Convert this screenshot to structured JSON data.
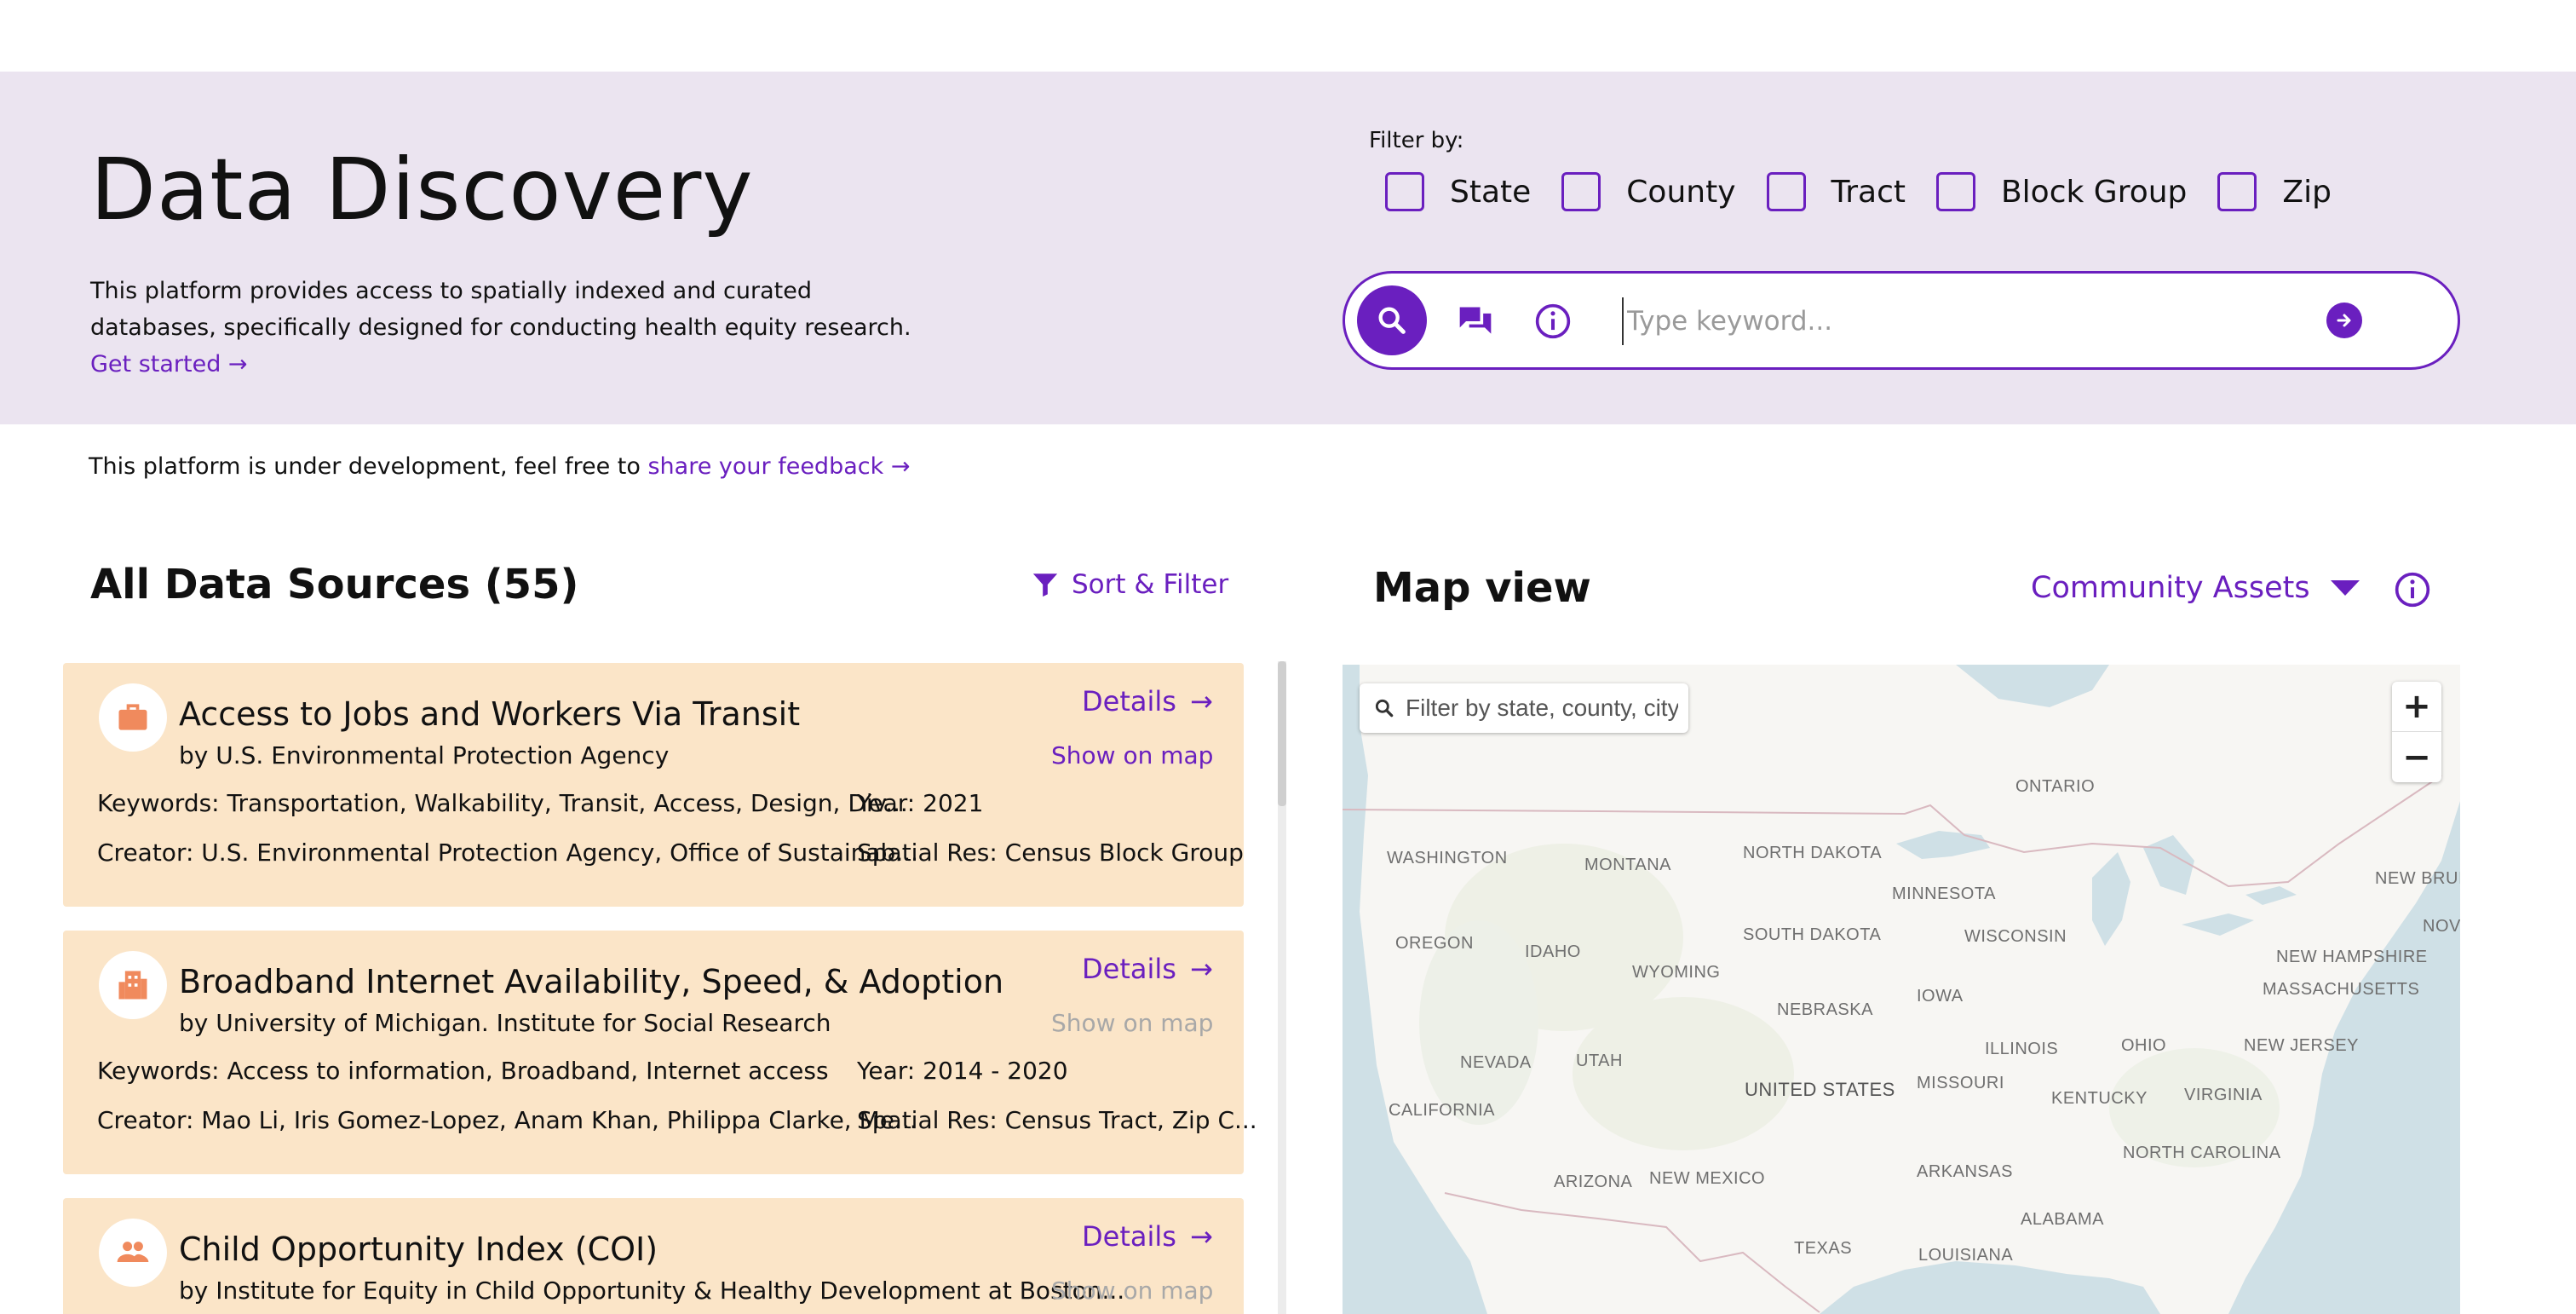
{
  "hero": {
    "title": "Data Discovery",
    "description": "This platform provides access to spatially indexed and curated databases, specifically designed for conducting health equity research.",
    "get_started": "Get started →"
  },
  "filter": {
    "label": "Filter by:",
    "options": [
      "State",
      "County",
      "Tract",
      "Block Group",
      "Zip"
    ]
  },
  "search": {
    "placeholder": "Type keyword...",
    "icons": [
      "search-icon",
      "chat-icon",
      "info-icon",
      "arrow-right-icon"
    ]
  },
  "notice": {
    "text": "This platform is under development, feel free to",
    "link": "share your feedback →"
  },
  "list": {
    "title": "All Data Sources (55)",
    "sort_filter": "Sort & Filter",
    "cards": [
      {
        "icon": "briefcase-icon",
        "title": "Access to Jobs and Workers Via Transit",
        "by": "by U.S. Environmental Protection Agency",
        "details": "Details",
        "show_on_map": "Show on map",
        "show_on_map_enabled": true,
        "keywords": "Keywords: Transportation, Walkability, Transit, Access, Design, Div...",
        "year": "Year: 2021",
        "creator": "Creator: U.S. Environmental Protection Agency, Office of Sustainab...",
        "spatial_res": "Spatial Res: Census Block Group"
      },
      {
        "icon": "building-icon",
        "title": "Broadband Internet Availability, Speed, & Adoption",
        "by": "by University of Michigan. Institute for Social Research",
        "details": "Details",
        "show_on_map": "Show on map",
        "show_on_map_enabled": false,
        "keywords": "Keywords: Access to information, Broadband, Internet access",
        "year": "Year: 2014 - 2020",
        "creator": "Creator: Mao Li, Iris Gomez-Lopez, Anam Khan, Philippa Clarke, Me...",
        "spatial_res": "Spatial Res: Census Tract, Zip C..."
      },
      {
        "icon": "people-icon",
        "title": "Child Opportunity Index (COI)",
        "by": "by Institute for Equity in Child Opportunity & Healthy Development at Boston...",
        "details": "Details",
        "show_on_map": "Show on map",
        "show_on_map_enabled": false
      }
    ]
  },
  "map": {
    "title": "Map view",
    "layer": "Community Assets",
    "search_placeholder": "Filter by state, county, city, or zip",
    "zoom_in": "+",
    "zoom_out": "−",
    "labels": {
      "ontario": "ONTARIO",
      "washington": "WASHINGTON",
      "montana": "MONTANA",
      "north_dakota": "NORTH DAKOTA",
      "minnesota": "MINNESOTA",
      "new_brunswick": "NEW BRUI",
      "nova": "NOV",
      "oregon": "OREGON",
      "idaho": "IDAHO",
      "wyoming": "WYOMING",
      "south_dakota": "SOUTH DAKOTA",
      "wisconsin": "WISCONSIN",
      "new_hampshire": "NEW HAMPSHIRE",
      "massachusetts": "MASSACHUSETTS",
      "iowa": "IOWA",
      "nebraska": "NEBRASKA",
      "illinois": "ILLINOIS",
      "ohio": "OHIO",
      "new_jersey": "NEW JERSEY",
      "nevada": "NEVADA",
      "utah": "UTAH",
      "united_states": "UNITED STATES",
      "missouri": "MISSOURI",
      "kentucky": "KENTUCKY",
      "virginia": "VIRGINIA",
      "california": "CALIFORNIA",
      "north_carolina": "NORTH CAROLINA",
      "arizona": "ARIZONA",
      "new_mexico": "NEW MEXICO",
      "arkansas": "ARKANSAS",
      "alabama": "ALABAMA",
      "texas": "TEXAS",
      "louisiana": "LOUISIANA"
    }
  },
  "colors": {
    "accent": "#6a1fbf",
    "hero_bg": "#ebe4f0",
    "card_bg": "#fbe5c8",
    "card_icon": "#f08a5d",
    "water": "#cfe0e6"
  }
}
